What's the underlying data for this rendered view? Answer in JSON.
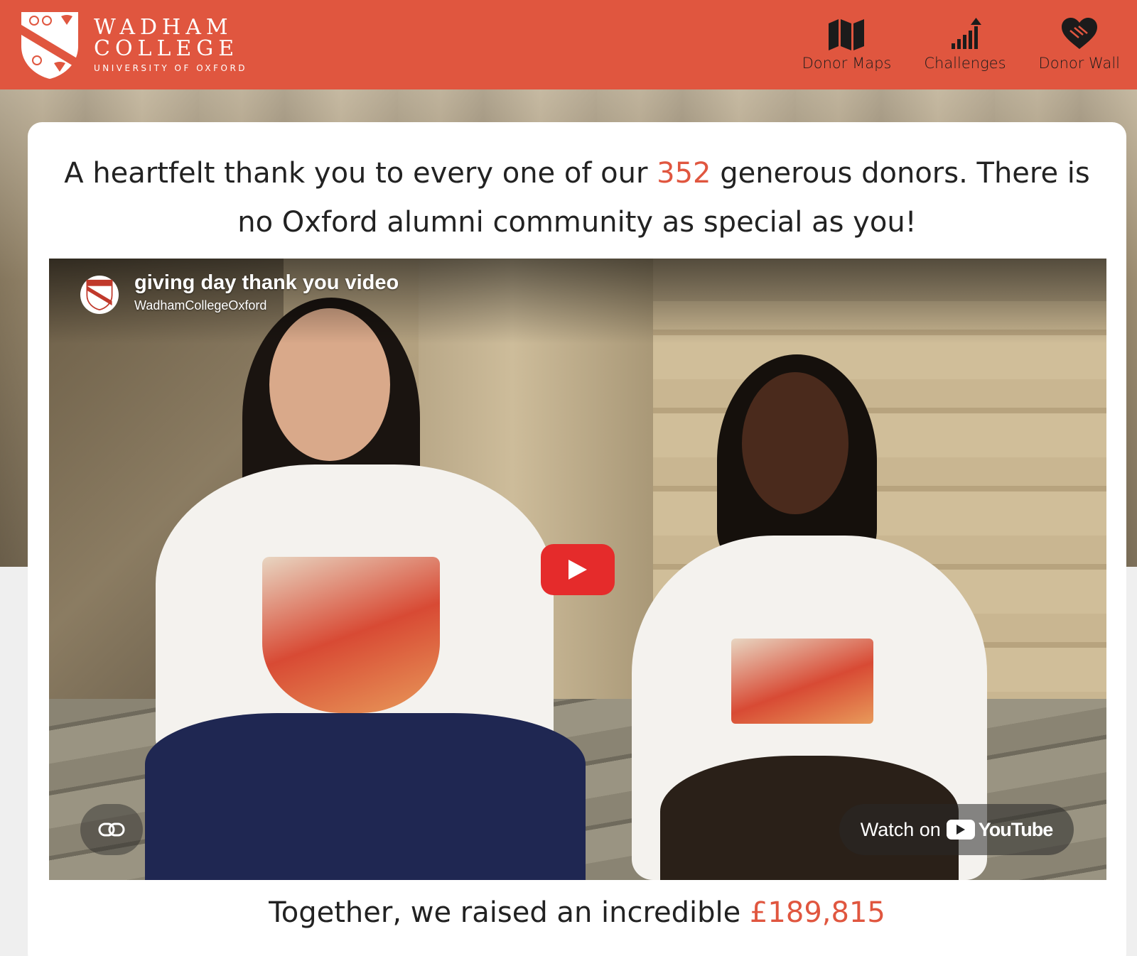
{
  "header": {
    "brand_name_line1": "WADHAM",
    "brand_name_line2": "COLLEGE",
    "brand_subtitle": "UNIVERSITY OF OXFORD",
    "nav": [
      {
        "label": "Donor Maps",
        "icon": "map-icon"
      },
      {
        "label": "Challenges",
        "icon": "chart-up-icon"
      },
      {
        "label": "Donor Wall",
        "icon": "heart-hands-icon"
      }
    ]
  },
  "thanks": {
    "before": "A heartfelt thank you to every one of our ",
    "donor_count": "352",
    "after": " generous donors. There is no Oxford alumni community as special as you!"
  },
  "video": {
    "title": "giving day thank you video",
    "channel": "WadhamCollegeOxford",
    "watch_on": "Watch on",
    "platform": "YouTube"
  },
  "raised": {
    "before": "Together, we raised an incredible ",
    "amount": "£189,815"
  },
  "colors": {
    "brand": "#e0563f",
    "play": "#e52b2b"
  }
}
